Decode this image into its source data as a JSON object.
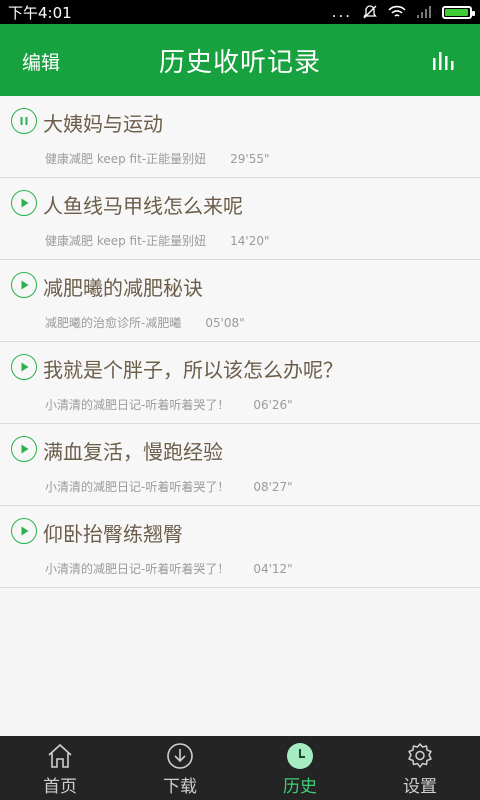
{
  "status": {
    "time": "下午4:01",
    "dots": "...",
    "battery_level": 0.95
  },
  "header": {
    "edit_label": "编辑",
    "title": "历史收听记录",
    "eq_icon": "equalizer-icon"
  },
  "accent": "#17a23f",
  "items": [
    {
      "title": "大姨妈与运动",
      "source": "健康减肥 keep fit-正能量别妞",
      "duration": "29'55\"",
      "state": "paused"
    },
    {
      "title": "人鱼线马甲线怎么来呢",
      "source": "健康减肥 keep fit-正能量别妞",
      "duration": "14'20\"",
      "state": "play"
    },
    {
      "title": "减肥曦的减肥秘诀",
      "source": "减肥曦的治愈诊所-减肥曦",
      "duration": "05'08\"",
      "state": "play"
    },
    {
      "title": "我就是个胖子，所以该怎么办呢？",
      "source": "小清清的减肥日记-听着听着哭了！",
      "duration": "06'26\"",
      "state": "play"
    },
    {
      "title": "满血复活，慢跑经验",
      "source": "小清清的减肥日记-听着听着哭了！",
      "duration": "08'27\"",
      "state": "play"
    },
    {
      "title": "仰卧抬臀练翘臀",
      "source": "小清清的减肥日记-听着听着哭了！",
      "duration": "04'12\"",
      "state": "play"
    }
  ],
  "tabs": [
    {
      "label": "首页",
      "icon": "home-icon"
    },
    {
      "label": "下载",
      "icon": "download-icon"
    },
    {
      "label": "历史",
      "icon": "clock-icon",
      "active": true
    },
    {
      "label": "设置",
      "icon": "gear-icon"
    }
  ]
}
